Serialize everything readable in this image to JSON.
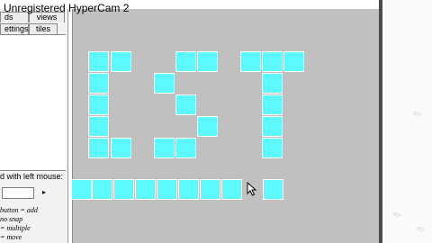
{
  "window": {
    "title": "Unregistered HyperCam 2"
  },
  "sidebar": {
    "tabs_row1": [
      "ds",
      "views"
    ],
    "tabs_row2": [
      "ettings",
      "tiles"
    ],
    "hint_label": "d with left mouse:",
    "help_lines": [
      "button = add",
      "no snap",
      "= multiple",
      "= move"
    ]
  },
  "canvas": {
    "letters": [
      "E",
      "S",
      "T"
    ],
    "tile_color": "#5cfaff",
    "background_color": "#c0c0c0"
  },
  "icons": {
    "cursor": "arrow-cursor-icon",
    "decor": "tool-icon"
  }
}
